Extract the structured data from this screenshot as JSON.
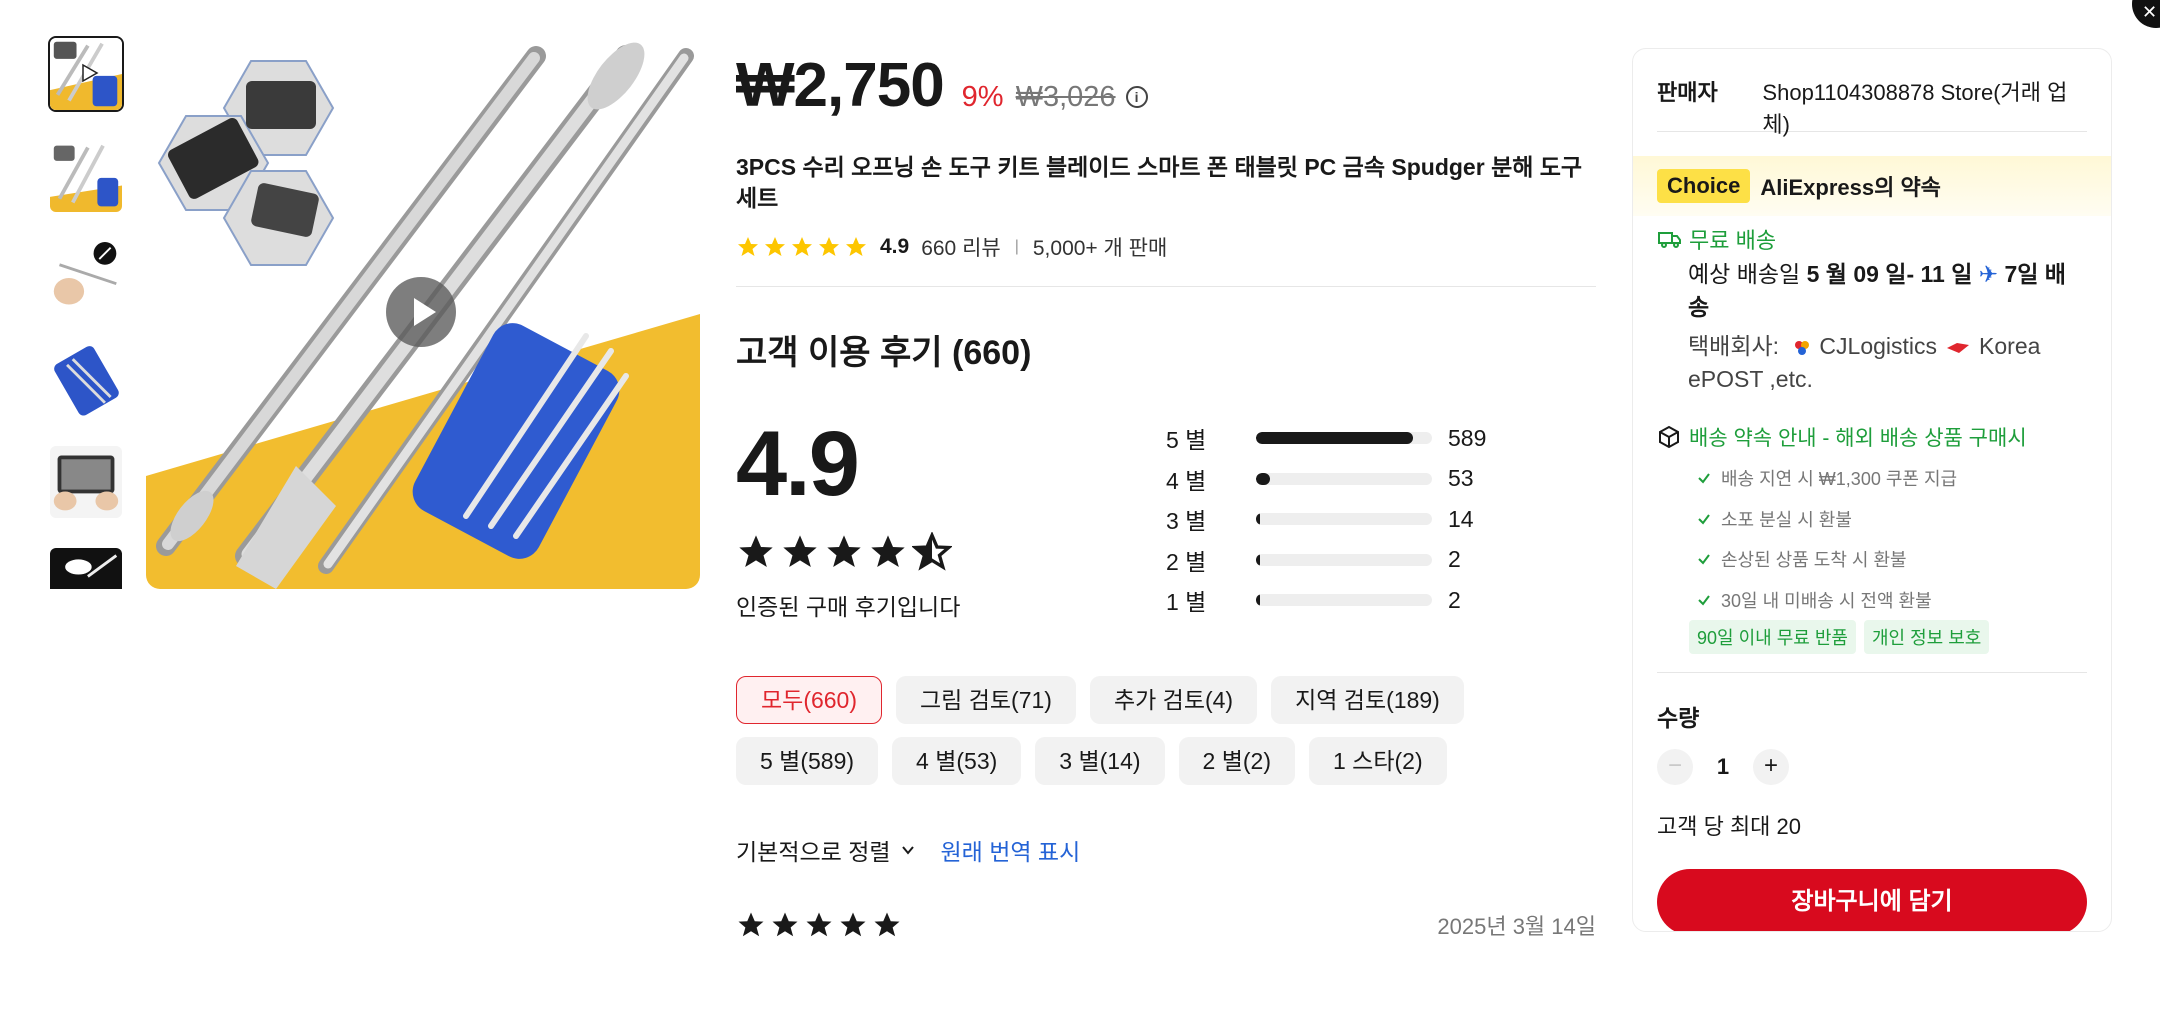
{
  "price": {
    "current": "₩2,750",
    "discount": "9%",
    "original": "₩3,026",
    "info_icon": "info-icon"
  },
  "product": {
    "title": "3PCS 수리 오프닝 손 도구 키트 블레이드 스마트 폰 태블릿 PC 금속 Spudger 분해 도구 세트",
    "rating": "4.9",
    "reviews": "660 리뷰",
    "sold": "5,000+ 개 판매"
  },
  "reviews_section": {
    "title": "고객 이용 후기 (660)",
    "score": "4.9",
    "star_rating": 4.9,
    "verified": "인증된 구매 후기입니다",
    "distribution": [
      {
        "label": "5 별",
        "count": "589",
        "fraction": 0.892
      },
      {
        "label": "4 별",
        "count": "53",
        "fraction": 0.08
      },
      {
        "label": "3 별",
        "count": "14",
        "fraction": 0.021
      },
      {
        "label": "2 별",
        "count": "2",
        "fraction": 0.003
      },
      {
        "label": "1 별",
        "count": "2",
        "fraction": 0.003
      }
    ],
    "filters_row1": [
      "모두(660)",
      "그림 검토(71)",
      "추가 검토(4)",
      "지역 검토(189)"
    ],
    "filters_row2": [
      "5 별(589)",
      "4 별(53)",
      "3 별(14)",
      "2 별(2)",
      "1 스타(2)"
    ],
    "sort_label": "기본적으로 정렬",
    "translate_label": "원래 번역 표시",
    "first_review": {
      "stars": 5,
      "date": "2025년 3월 14일"
    }
  },
  "panel": {
    "seller_label": "판매자",
    "seller_name": "Shop1104308878 Store(거래 업체)",
    "choice_tag": "Choice",
    "choice_text": "AliExpress의 약속",
    "free_shipping": "무료 배송",
    "delivery_prefix": "예상 배송일 ",
    "delivery_dates": "5 월 09 일- 11 일",
    "delivery_days": "7일 배송",
    "carrier_prefix": "택배회사: ",
    "carrier_1": "CJLogistics",
    "carrier_2": "Korea ePOST ,etc.",
    "promise_head": "배송 약속 안내 - 해외 배송 상품 구매시",
    "promises": [
      "배송 지연 시 ₩1,300 쿠폰 지급",
      "소포 분실 시 환불",
      "손상된 상품 도착 시 환불",
      "30일 내 미배송 시 전액 환불"
    ],
    "badges": [
      "90일 이내 무료 반품",
      "개인 정보 보호"
    ],
    "qty_label": "수량",
    "qty_value": "1",
    "qty_max": "고객 당 최대 20",
    "cart_label": "장바구니에 담기"
  },
  "colors": {
    "accent_red": "#d80a1e",
    "discount_red": "#e0262e",
    "green": "#1e9e3b",
    "link_blue": "#2463d6",
    "choice_yellow": "#fde046"
  }
}
